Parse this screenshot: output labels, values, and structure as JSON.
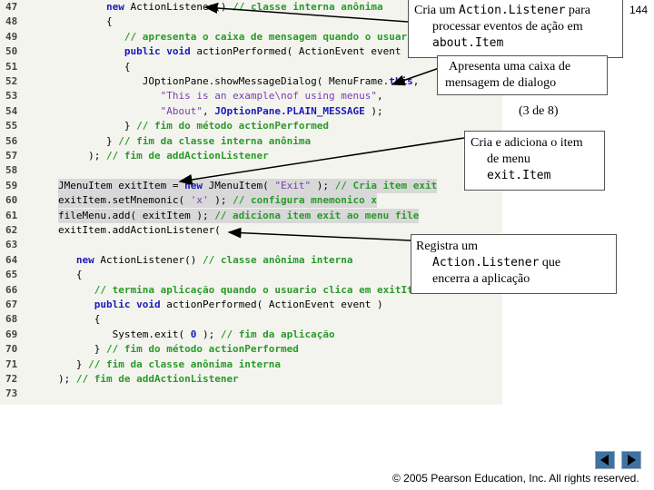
{
  "slide_number": "144",
  "page_indicator": "(3 de 8)",
  "copyright": "© 2005 Pearson Education, Inc. All rights reserved.",
  "code_lines": [
    {
      "n": "47",
      "hl": false,
      "t": [
        [
          "        ",
          "pl"
        ],
        [
          "new ",
          "kw"
        ],
        [
          "ActionListener() ",
          "pl"
        ],
        [
          "// classe interna anônima",
          "cm"
        ]
      ]
    },
    {
      "n": "48",
      "hl": false,
      "t": [
        [
          "        {",
          "pl"
        ]
      ]
    },
    {
      "n": "49",
      "hl": false,
      "t": [
        [
          "           ",
          "pl"
        ],
        [
          "// apresenta o caixa de mensagem quando o usuario se",
          "cm"
        ]
      ]
    },
    {
      "n": "50",
      "hl": false,
      "t": [
        [
          "           ",
          "pl"
        ],
        [
          "public void ",
          "kw"
        ],
        [
          "actionPerformed( ActionEvent event )",
          "pl"
        ]
      ]
    },
    {
      "n": "51",
      "hl": false,
      "t": [
        [
          "           {",
          "pl"
        ]
      ]
    },
    {
      "n": "52",
      "hl": false,
      "t": [
        [
          "              JOptionPane.showMessageDialog( MenuFrame.",
          "pl"
        ],
        [
          "this",
          "kw"
        ],
        [
          ",",
          "pl"
        ]
      ]
    },
    {
      "n": "53",
      "hl": false,
      "t": [
        [
          "                 ",
          "pl"
        ],
        [
          "\"This is an example\\nof using menus\"",
          "st"
        ],
        [
          ",",
          "pl"
        ]
      ]
    },
    {
      "n": "54",
      "hl": false,
      "t": [
        [
          "                 ",
          "pl"
        ],
        [
          "\"About\"",
          "st"
        ],
        [
          ", ",
          "pl"
        ],
        [
          "JOptionPane.PLAIN_MESSAGE",
          "kw"
        ],
        [
          " );",
          "pl"
        ]
      ]
    },
    {
      "n": "55",
      "hl": false,
      "t": [
        [
          "           } ",
          "pl"
        ],
        [
          "// fim do método actionPerformed",
          "cm"
        ]
      ]
    },
    {
      "n": "56",
      "hl": false,
      "t": [
        [
          "        } ",
          "pl"
        ],
        [
          "// fim da classe interna anônima",
          "cm"
        ]
      ]
    },
    {
      "n": "57",
      "hl": false,
      "t": [
        [
          "     ); ",
          "pl"
        ],
        [
          "// fim de addActionListener",
          "cm"
        ]
      ]
    },
    {
      "n": "58",
      "hl": false,
      "t": [
        [
          "",
          "pl"
        ]
      ]
    },
    {
      "n": "59",
      "hl": true,
      "t": [
        [
          "JMenuItem exitItem = ",
          "pl"
        ],
        [
          "new ",
          "kw"
        ],
        [
          "JMenuItem( ",
          "pl"
        ],
        [
          "\"Exit\"",
          "st"
        ],
        [
          " ); ",
          "pl"
        ],
        [
          "// Cria item exit",
          "cm"
        ]
      ]
    },
    {
      "n": "60",
      "hl": true,
      "t": [
        [
          "exitItem.setMnemonic( ",
          "pl"
        ],
        [
          "'x'",
          "st"
        ],
        [
          " ); ",
          "pl"
        ],
        [
          "// configura mnemonico x",
          "cm"
        ]
      ]
    },
    {
      "n": "61",
      "hl": true,
      "t": [
        [
          "fileMenu.add( exitItem ); ",
          "pl"
        ],
        [
          "// adiciona item exit ao menu file",
          "cm"
        ]
      ]
    },
    {
      "n": "62",
      "hl": false,
      "t": [
        [
          "exitItem.addActionListener(",
          "pl"
        ]
      ]
    },
    {
      "n": "63",
      "hl": false,
      "t": [
        [
          "",
          "pl"
        ]
      ]
    },
    {
      "n": "64",
      "hl": false,
      "t": [
        [
          "   ",
          "pl"
        ],
        [
          "new ",
          "kw"
        ],
        [
          "ActionListener() ",
          "pl"
        ],
        [
          "// classe anônima interna",
          "cm"
        ]
      ]
    },
    {
      "n": "65",
      "hl": false,
      "t": [
        [
          "   {",
          "pl"
        ]
      ]
    },
    {
      "n": "66",
      "hl": false,
      "t": [
        [
          "      ",
          "pl"
        ],
        [
          "// termina aplicação quando o usuario clica em exitItem",
          "cm"
        ]
      ]
    },
    {
      "n": "67",
      "hl": false,
      "t": [
        [
          "      ",
          "pl"
        ],
        [
          "public void ",
          "kw"
        ],
        [
          "actionPerformed( ActionEvent event )",
          "pl"
        ]
      ]
    },
    {
      "n": "68",
      "hl": false,
      "t": [
        [
          "      {",
          "pl"
        ]
      ]
    },
    {
      "n": "69",
      "hl": false,
      "t": [
        [
          "         System.exit( ",
          "pl"
        ],
        [
          "0",
          "kw"
        ],
        [
          " ); ",
          "pl"
        ],
        [
          "// fim da aplicação",
          "cm"
        ]
      ]
    },
    {
      "n": "70",
      "hl": false,
      "t": [
        [
          "      } ",
          "pl"
        ],
        [
          "// fim do método actionPerformed",
          "cm"
        ]
      ]
    },
    {
      "n": "71",
      "hl": false,
      "t": [
        [
          "   } ",
          "pl"
        ],
        [
          "// fim da classe anônima interna",
          "cm"
        ]
      ]
    },
    {
      "n": "72",
      "hl": false,
      "t": [
        [
          "); ",
          "pl"
        ],
        [
          "// fim de addActionListener",
          "cm"
        ]
      ]
    },
    {
      "n": "73",
      "hl": false,
      "t": [
        [
          "",
          "pl"
        ]
      ]
    }
  ],
  "callouts": {
    "c1": {
      "a": "Cria um ",
      "b": "Action.Listener",
      "c": " para",
      "d": "processar eventos de ação em",
      "e": "about.Item"
    },
    "c2": {
      "a": "Apresenta uma caixa de",
      "b": "mensagem de dialogo"
    },
    "c3": {
      "a": "Cria e adiciona o item",
      "b": "de menu",
      "c": "exit.Item"
    },
    "c4": {
      "a": "Registra um",
      "b": "Action.Listener",
      "c": " que",
      "d": "encerra a aplicação"
    }
  },
  "nav": {
    "prev": "previous-arrow-icon",
    "next": "next-arrow-icon"
  }
}
